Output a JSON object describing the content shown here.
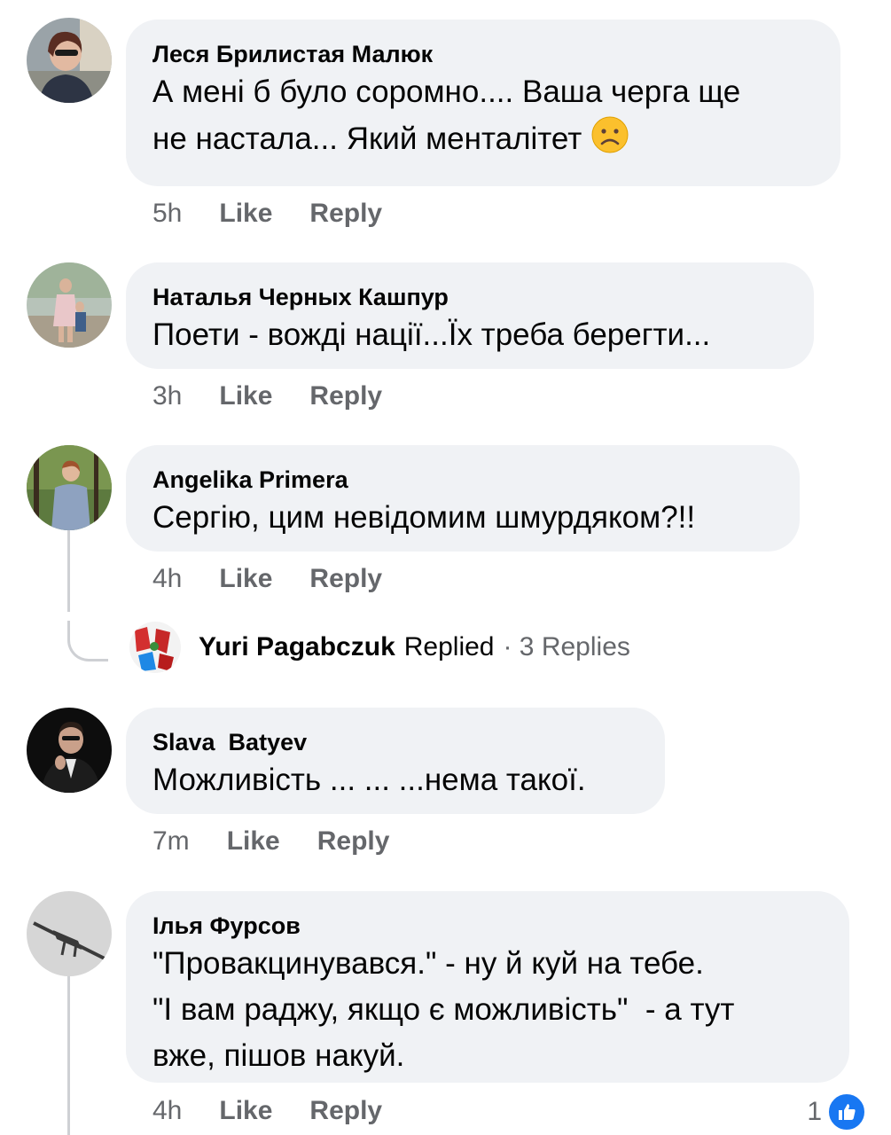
{
  "colors": {
    "bubble": "#f0f2f5",
    "meta": "#65676b",
    "like_blue": "#1877f2"
  },
  "comments": [
    {
      "author": "Леся Брилистая Малюк",
      "lines": [
        "А мені б було соромно.... Ваша черга ще",
        "не настала... Який менталітет"
      ],
      "emoji": "frowning-face-icon",
      "time": "5h",
      "like": "Like",
      "reply": "Reply"
    },
    {
      "author": "Наталья Черных Кашпур",
      "lines": [
        "Поети - вожді нації...Їх треба берегти..."
      ],
      "time": "3h",
      "like": "Like",
      "reply": "Reply"
    },
    {
      "author": "Angelika Primera",
      "lines": [
        "Сергію, цим невідомим шмурдяком?!!"
      ],
      "time": "4h",
      "like": "Like",
      "reply": "Reply",
      "replies_summary": {
        "name": "Yuri Pagabczuk",
        "action": "Replied",
        "count": "· 3 Replies"
      }
    },
    {
      "author": "Slava  Batyev",
      "lines": [
        "Можливість ... ... ...нема такої."
      ],
      "time": "7m",
      "like": "Like",
      "reply": "Reply"
    },
    {
      "author": "Ілья Фурсов",
      "lines": [
        "\"Провакцинувався.\" - ну й куй на тебе.",
        "\"І вам раджу, якщо є можливість\"  - а тут",
        "вже, пішов накуй."
      ],
      "time": "4h",
      "like": "Like",
      "reply": "Reply",
      "reaction_count": "1",
      "reaction_icon": "like-thumb-icon"
    }
  ]
}
